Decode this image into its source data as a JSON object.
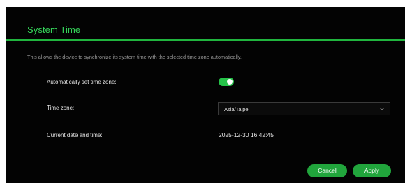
{
  "dialog": {
    "title": "System Time",
    "description": "This allows the device to synchronize its system time with the selected time zone automatically."
  },
  "auto_timezone": {
    "label": "Automatically set time zone:",
    "enabled": true
  },
  "timezone": {
    "label": "Time zone:",
    "selected": "Asia/Taipei"
  },
  "current_time": {
    "label": "Current date and time:",
    "value": "2025-12-30 16:42:45"
  },
  "buttons": {
    "cancel_label": "Cancel",
    "apply_label": "Apply"
  },
  "colors": {
    "accent": "#21a53c",
    "title": "#35d55a",
    "background": "#030303"
  },
  "icons": {
    "dropdown": "chevron-down-icon"
  }
}
